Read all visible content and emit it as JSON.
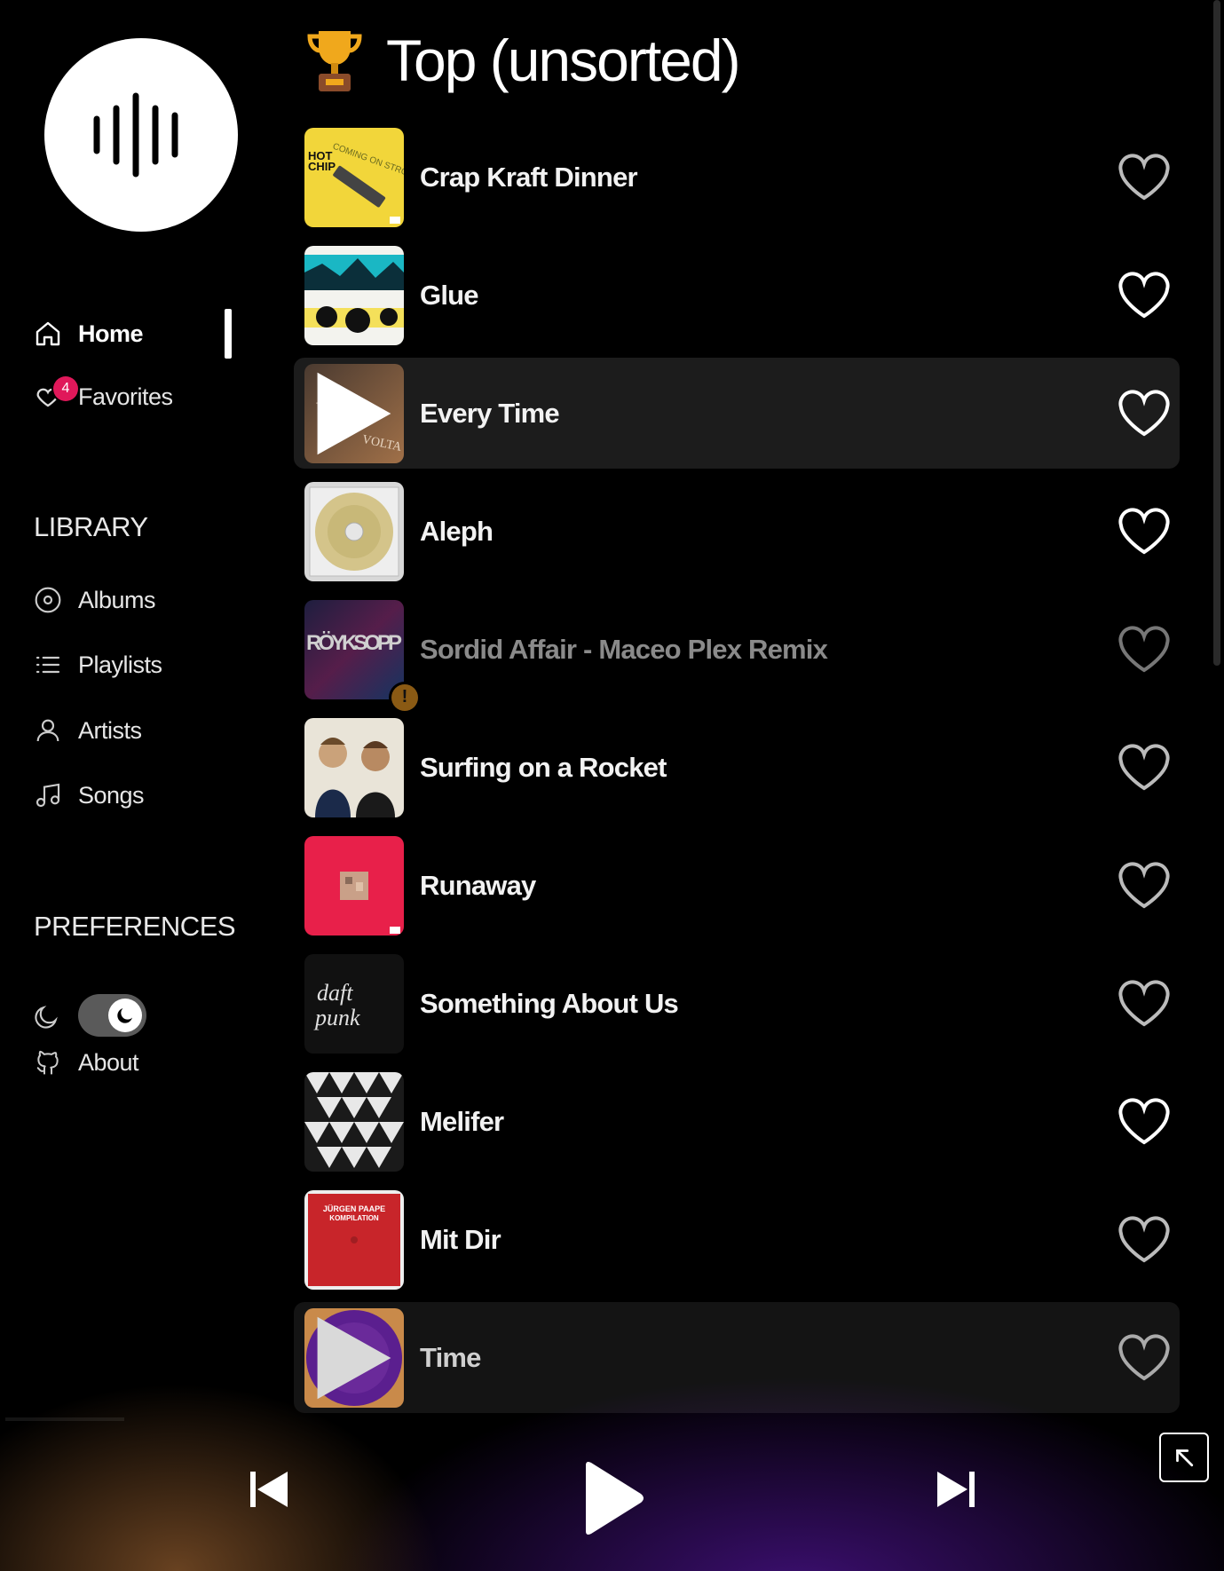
{
  "sidebar": {
    "nav": [
      {
        "label": "Home",
        "icon": "home-icon",
        "active": true
      },
      {
        "label": "Favorites",
        "icon": "heart-icon",
        "badge": "4"
      }
    ],
    "library_title": "LIBRARY",
    "library": [
      {
        "label": "Albums",
        "icon": "disc-icon"
      },
      {
        "label": "Playlists",
        "icon": "list-icon"
      },
      {
        "label": "Artists",
        "icon": "person-icon"
      },
      {
        "label": "Songs",
        "icon": "music-note-icon"
      }
    ],
    "preferences_title": "PREFERENCES",
    "dark_mode": true,
    "about_label": "About"
  },
  "main": {
    "title": "Top (unsorted)",
    "tracks": [
      {
        "name": "Crap Kraft Dinner",
        "liked": false
      },
      {
        "name": "Glue",
        "liked": true
      },
      {
        "name": "Every Time",
        "liked": true
      },
      {
        "name": "Aleph",
        "liked": true
      },
      {
        "name": "Sordid Affair - Maceo Plex Remix",
        "liked": false,
        "unavailable": true
      },
      {
        "name": "Surfing on a Rocket",
        "liked": false
      },
      {
        "name": "Runaway",
        "liked": false
      },
      {
        "name": "Something About Us",
        "liked": false
      },
      {
        "name": "Melifer",
        "liked": true
      },
      {
        "name": "Mit Dir",
        "liked": false
      },
      {
        "name": "Time",
        "liked": false
      }
    ]
  },
  "colors": {
    "badge": "#e0185a",
    "warning": "#8a5a14",
    "accent_purple": "#5b1f8f"
  }
}
